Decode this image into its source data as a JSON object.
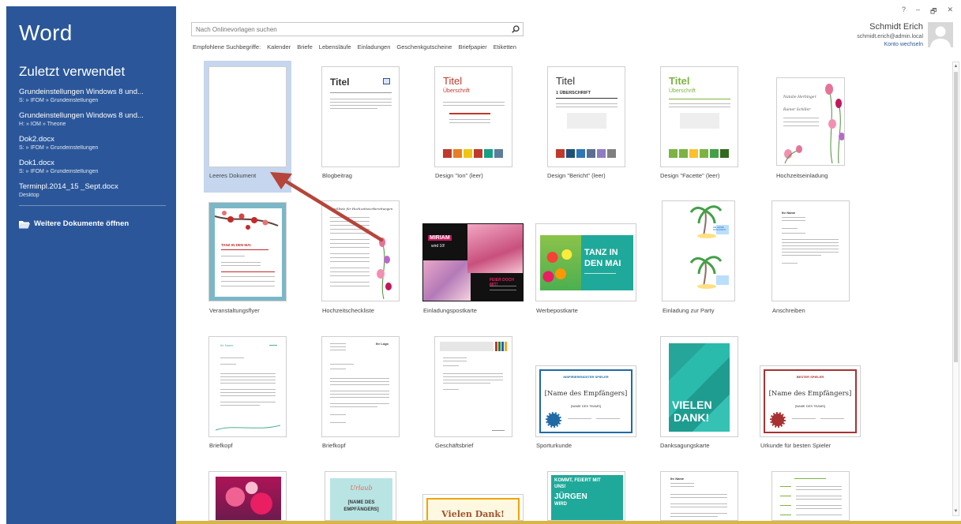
{
  "app": {
    "name": "Word"
  },
  "sidebar": {
    "heading": "Zuletzt verwendet",
    "recent": [
      {
        "name": "Grundeinstellungen Windows 8  und...",
        "path": "S: » IFOM » Grundeinstellungen"
      },
      {
        "name": "Grundeinstellungen Windows 8  und...",
        "path": "H: » IOM » Theorie"
      },
      {
        "name": "Dok2.docx",
        "path": "S: » IFOM » Grundeinstellungen"
      },
      {
        "name": "Dok1.docx",
        "path": "S: » IFOM » Grundeinstellungen"
      },
      {
        "name": "Terminpl.2014_15 _Sept.docx",
        "path": "Desktop"
      }
    ],
    "open_more": "Weitere Dokumente öffnen"
  },
  "search": {
    "placeholder": "Nach Onlinevorlagen suchen",
    "value": ""
  },
  "suggestions": {
    "label": "Empfohlene Suchbegriffe:",
    "items": [
      "Kalender",
      "Briefe",
      "Lebensläufe",
      "Einladungen",
      "Geschenkgutscheine",
      "Briefpapier",
      "Etiketten"
    ]
  },
  "window": {
    "help": "?",
    "minimize": "–",
    "restore": "🗗",
    "close": "✕"
  },
  "account": {
    "name": "Schmidt Erich",
    "email": "schmidt.erich@admin.local",
    "switch": "Konto wechseln"
  },
  "templates": {
    "t0": {
      "caption": "Leeres Dokument"
    },
    "t1": {
      "caption": "Blogbeitrag",
      "title": "Titel"
    },
    "t2": {
      "caption": "Design \"Ion\" (leer)",
      "title": "Titel",
      "sub": "Überschrift"
    },
    "t3": {
      "caption": "Design \"Bericht\" (leer)",
      "title": "Titel",
      "sub": "1   ÜBERSCHRIFT"
    },
    "t4": {
      "caption": "Design \"Facette\" (leer)",
      "title": "Titel",
      "sub": "Überschrift"
    },
    "t5": {
      "caption": "Hochzeitseinladung",
      "l1": "Natalie Herbinger",
      "l2": "Rainer Schiller"
    },
    "t6": {
      "caption": "Veranstaltungsflyer",
      "l1": "TANZ IN DEN MAI"
    },
    "t7": {
      "caption": "Hochzeitscheckliste",
      "l1": "Checkliste für Hochzeitsvorbereitungen"
    },
    "t8": {
      "caption": "Einladungspostkarte",
      "l1": "MIRIAM",
      "l2": "wird 10!",
      "l3": "FEIER DOCH MIT!"
    },
    "t9": {
      "caption": "Werbepostkarte",
      "l1": "TANZ IN",
      "l2": "DEN MAI"
    },
    "t10": {
      "caption": "Einladung zur Party",
      "l1": "DIE GROßE SCHULPARTY"
    },
    "t11": {
      "caption": "Anschreiben",
      "l1": "Ihr Name"
    },
    "t12": {
      "caption": "Briefkopf",
      "l1": "Ihr Name"
    },
    "t13": {
      "caption": "Briefkopf",
      "l1": "Ihr Logo"
    },
    "t14": {
      "caption": "Geschäftsbrief"
    },
    "t15": {
      "caption": "Sporturkunde",
      "l1": "INSPIRIERENDSTER SPIELER",
      "l2": "[Name des Empfängers]",
      "l3": "[NAME DES TEAMS]"
    },
    "t16": {
      "caption": "Danksagungskarte",
      "l1": "VIELEN",
      "l2": "DANK!"
    },
    "t17": {
      "caption": "Urkunde für besten Spieler",
      "l1": "BESTER SPIELER",
      "l2": "[Name des Empfängers]",
      "l3": "[NAME DES TEAMS]"
    },
    "t19": {
      "l1": "Urlaub",
      "l2": "[NAME DES",
      "l3": "EMPFÄNGERS]"
    },
    "t20": {
      "l1": "Vielen Dank!"
    },
    "t21": {
      "l1": "KOMMT, FEIERT MIT",
      "l2": "UNS!",
      "l3": "JÜRGEN",
      "l4": "WIRD"
    },
    "t22": {
      "l1": "Ihr Name"
    }
  },
  "colors": {
    "accent": "#2b579a",
    "selection": "#c5d6ee",
    "arrow": "#b5453a"
  }
}
